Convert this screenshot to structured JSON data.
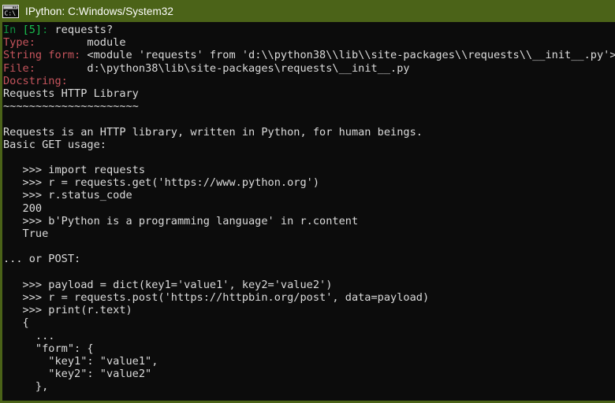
{
  "window": {
    "title": "IPython: C:Windows/System32",
    "icon": "console-icon",
    "titlebar_color": "#4b6318",
    "terminal_bg": "#0c0c0c",
    "text_color": "#dcdcdc",
    "prompt_color": "#0f8f3f",
    "label_color": "#c5545c"
  },
  "terminal": {
    "prompt": {
      "in_label": "In",
      "number": "[5]",
      "colon": ":",
      "command": " requests?"
    },
    "info": [
      {
        "label": "Type:",
        "pad": "        ",
        "value": "module"
      },
      {
        "label": "String form:",
        "pad": " ",
        "value": "<module 'requests' from 'd:\\\\python38\\\\lib\\\\site-packages\\\\requests\\\\__init__.py'>"
      },
      {
        "label": "File:",
        "pad": "        ",
        "value": "d:\\python38\\lib\\site-packages\\requests\\__init__.py"
      },
      {
        "label": "Docstring:",
        "pad": "",
        "value": ""
      }
    ],
    "docstring": {
      "heading": "Requests HTTP Library",
      "underline": "~~~~~~~~~~~~~~~~~~~~~",
      "blank1": "",
      "intro": "Requests is an HTTP library, written in Python, for human beings.",
      "basic_usage": "Basic GET usage:",
      "blank2": "",
      "get_example": [
        "   >>> import requests",
        "   >>> r = requests.get('https://www.python.org')",
        "   >>> r.status_code",
        "   200",
        "   >>> b'Python is a programming language' in r.content",
        "   True",
        ""
      ],
      "post_heading": "... or POST:",
      "blank3": "",
      "post_example": [
        "   >>> payload = dict(key1='value1', key2='value2')",
        "   >>> r = requests.post('https://httpbin.org/post', data=payload)",
        "   >>> print(r.text)",
        "   {",
        "     ...",
        "     \"form\": {",
        "       \"key1\": \"value1\",",
        "       \"key2\": \"value2\"",
        "     },"
      ]
    }
  }
}
